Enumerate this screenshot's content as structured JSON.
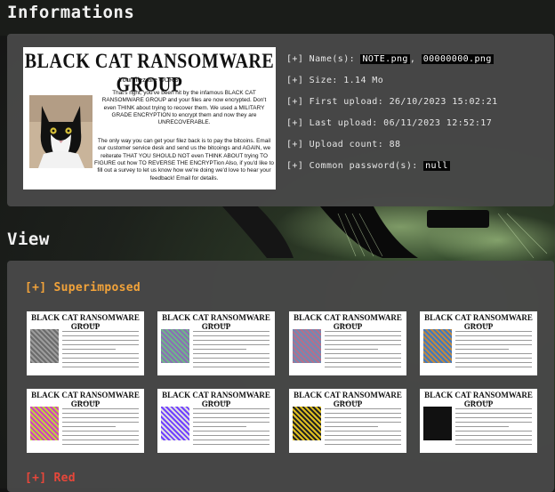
{
  "headings": {
    "info": "Informations",
    "view": "View"
  },
  "note": {
    "title": "BLACK CAT RANSOMWARE GROUP",
    "subtitle": "Your filez are OURS!",
    "para1": "That's right, you've been hit by the infamous BLACK CAT RANSOMWARE GROUP and your files are now encrypted. Don't even THINK about trying to recover them. We used a MILITARY GRADE ENCRYPTION to encrypt them and now they are UNRECOVERABLE.",
    "para2": "The only way you can get your filez back is to pay the bitcoins. Email our customer service desk and send us the bitcoings and AGAIN, we reiterate THAT YOU SHOULD NOT even THINK ABOUT trying TO FIGURE out how TO REVERSE THE ENCRYPTion Also, if you'd like to fill out a survey to let us know how we're doing we'd love to hear your feedback! Email for details."
  },
  "meta": {
    "names_prefix": "[+] Name(s): ",
    "name1": "NOTE.png",
    "names_sep": ", ",
    "name2": "00000000.png",
    "size": "[+] Size: 1.14 Mo",
    "first_upload": "[+] First upload: 26/10/2023 15:02:21",
    "last_upload": "[+] Last upload: 06/11/2023 12:52:17",
    "upload_count": "[+] Upload count: 88",
    "password_prefix": "[+] Common password(s): ",
    "password": "null"
  },
  "view": {
    "superimposed_title": "[+] Superimposed",
    "red_title": "[+] Red",
    "thumbnails": [
      {
        "label": "superimposed-1",
        "title": "BLACK CAT RANSOMWARE GROUP",
        "subtitle": "Your filez are OURS!"
      },
      {
        "label": "superimposed-2",
        "title": "BLACK CAT RANSOMWARE GROUP",
        "subtitle": "Your filez are OURS!"
      },
      {
        "label": "superimposed-3",
        "title": "BLACK CAT RANSOMWARE GROUP",
        "subtitle": "Your filez are OURS!"
      },
      {
        "label": "superimposed-4",
        "title": "BLACK CAT RANSOMWARE GROUP",
        "subtitle": "Your filez are OURS!"
      },
      {
        "label": "superimposed-5",
        "title": "BLACK CAT RANSOMWARE GROUP",
        "subtitle": "Your filez are OURS!"
      },
      {
        "label": "superimposed-6",
        "title": "BLACK CAT RANSOMWARE GROUP",
        "subtitle": "Your filez are OURS!"
      },
      {
        "label": "superimposed-7",
        "title": "BLACK CAT RANSOMWARE GROUP",
        "subtitle": "Your filez are OURS!"
      },
      {
        "label": "superimposed-8",
        "title": "BLACK CAT RANSOMWARE GROUP",
        "subtitle": "Your filez are OURS!"
      }
    ]
  },
  "colors": {
    "panel": "#484848",
    "superimposed": "#f2a33a",
    "red": "#e8473a",
    "highlight_bg": "#050505"
  },
  "icons": [
    "black-cat-photo-icon"
  ]
}
